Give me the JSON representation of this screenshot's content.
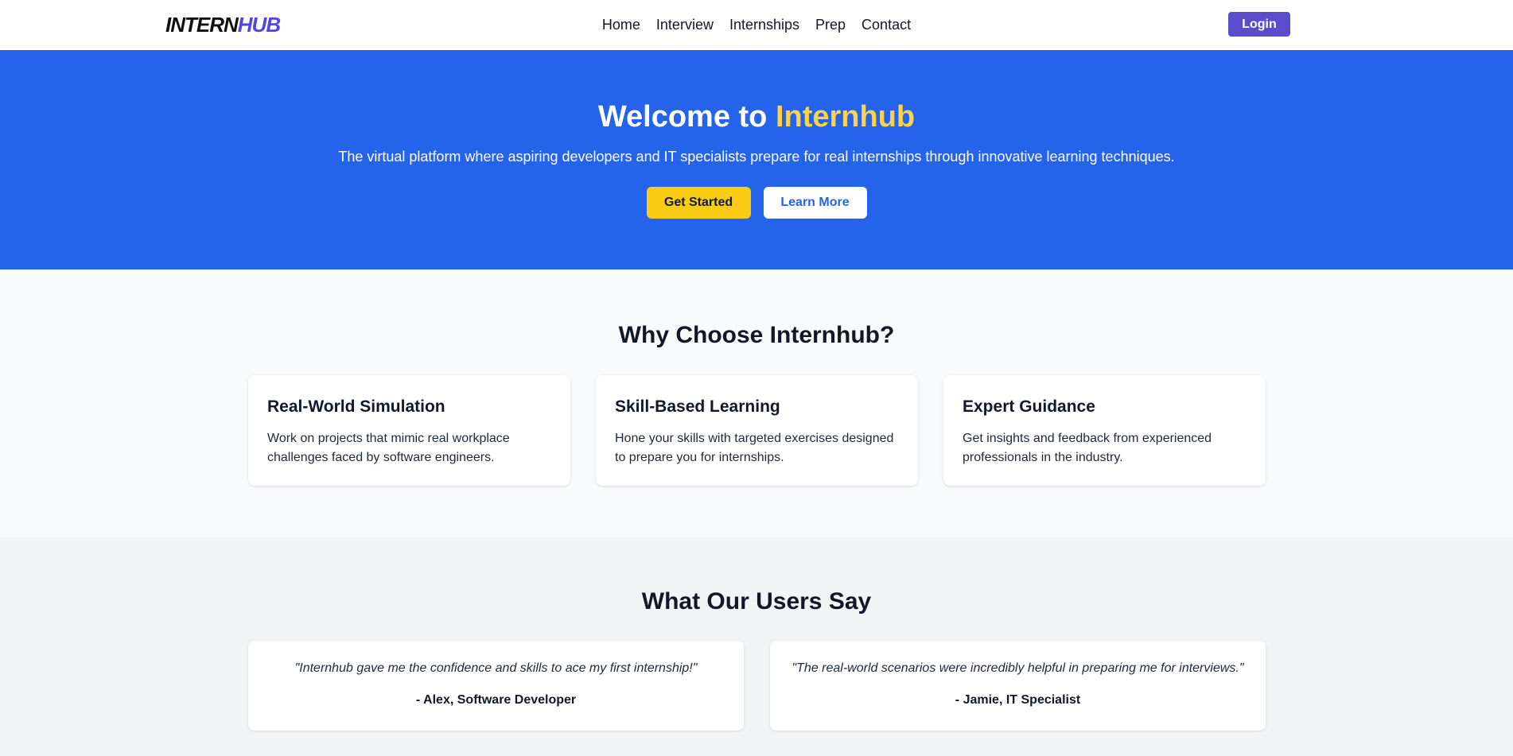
{
  "brand": {
    "part1": "INTERN",
    "part2": "HUB"
  },
  "nav": {
    "items": [
      {
        "label": "Home"
      },
      {
        "label": "Interview"
      },
      {
        "label": "Internships"
      },
      {
        "label": "Prep"
      },
      {
        "label": "Contact"
      }
    ],
    "login_label": "Login"
  },
  "hero": {
    "title_prefix": "Welcome to ",
    "title_highlight": "Internhub",
    "subtitle": "The virtual platform where aspiring developers and IT specialists prepare for real internships through innovative learning techniques.",
    "primary_button": "Get Started",
    "secondary_button": "Learn More"
  },
  "features": {
    "title": "Why Choose Internhub?",
    "cards": [
      {
        "title": "Real-World Simulation",
        "text": "Work on projects that mimic real workplace challenges faced by software engineers."
      },
      {
        "title": "Skill-Based Learning",
        "text": "Hone your skills with targeted exercises designed to prepare you for internships."
      },
      {
        "title": "Expert Guidance",
        "text": "Get insights and feedback from experienced professionals in the industry."
      }
    ]
  },
  "testimonials": {
    "title": "What Our Users Say",
    "items": [
      {
        "quote": "\"Internhub gave me the confidence and skills to ace my first internship!\"",
        "author": "- Alex, Software Developer"
      },
      {
        "quote": "\"The real-world scenarios were incredibly helpful in preparing me for interviews.\"",
        "author": "- Jamie, IT Specialist"
      }
    ]
  },
  "colors": {
    "brand_accent": "#4f46e5",
    "login_button": "#5b4ccc",
    "hero_background": "#2563eb",
    "hero_highlight": "#fcd34d",
    "primary_button": "#facc15"
  }
}
